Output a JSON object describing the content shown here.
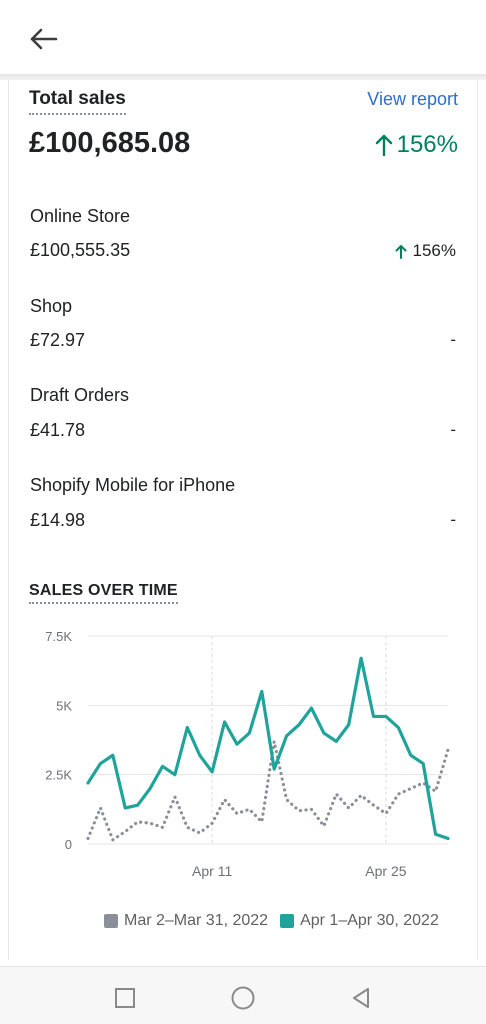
{
  "header": {
    "back_icon": "arrow-left-icon"
  },
  "total_sales": {
    "title": "Total sales",
    "view_report": "View report",
    "value": "£100,685.08",
    "change": "156%",
    "change_color": "#008060"
  },
  "channels": [
    {
      "name": "Online Store",
      "value": "£100,555.35",
      "change": "156%",
      "has_arrow": true
    },
    {
      "name": "Shop",
      "value": "£72.97",
      "change": "-",
      "has_arrow": false
    },
    {
      "name": "Draft Orders",
      "value": "£41.78",
      "change": "-",
      "has_arrow": false
    },
    {
      "name": "Shopify Mobile for iPhone",
      "value": "£14.98",
      "change": "-",
      "has_arrow": false
    }
  ],
  "sales_over_time": {
    "title": "SALES OVER TIME"
  },
  "chart_data": {
    "type": "line",
    "x_tick_labels": [
      "Apr 11",
      "Apr 25"
    ],
    "x_tick_days": [
      11,
      25
    ],
    "y_tick_labels": [
      "0",
      "2.5K",
      "5K",
      "7.5K"
    ],
    "y_ticks": [
      0,
      2500,
      5000,
      7500
    ],
    "ylim": [
      0,
      7500
    ],
    "xlim": [
      1,
      30
    ],
    "grid": true,
    "legend_position": "bottom",
    "series": [
      {
        "name": "Mar 2–Mar 31, 2022",
        "color": "#8a9099",
        "style": "dotted",
        "values": [
          200,
          1300,
          150,
          450,
          800,
          750,
          600,
          1700,
          600,
          400,
          750,
          1600,
          1100,
          1250,
          800,
          3700,
          1600,
          1200,
          1250,
          650,
          1800,
          1300,
          1750,
          1400,
          1100,
          1800,
          2000,
          2200,
          1900,
          3400
        ]
      },
      {
        "name": "Apr 1–Apr 30, 2022",
        "color": "#1fa39a",
        "style": "solid",
        "values": [
          2200,
          2900,
          3200,
          1300,
          1400,
          2000,
          2800,
          2500,
          4200,
          3200,
          2600,
          4400,
          3600,
          4000,
          5500,
          2700,
          3900,
          4300,
          4900,
          4000,
          3700,
          4300,
          6700,
          4600,
          4600,
          4200,
          3200,
          2900,
          350,
          200
        ]
      }
    ]
  },
  "nav": {
    "recents_icon": "square-recents-icon",
    "home_icon": "circle-home-icon",
    "back_icon": "triangle-back-icon"
  }
}
